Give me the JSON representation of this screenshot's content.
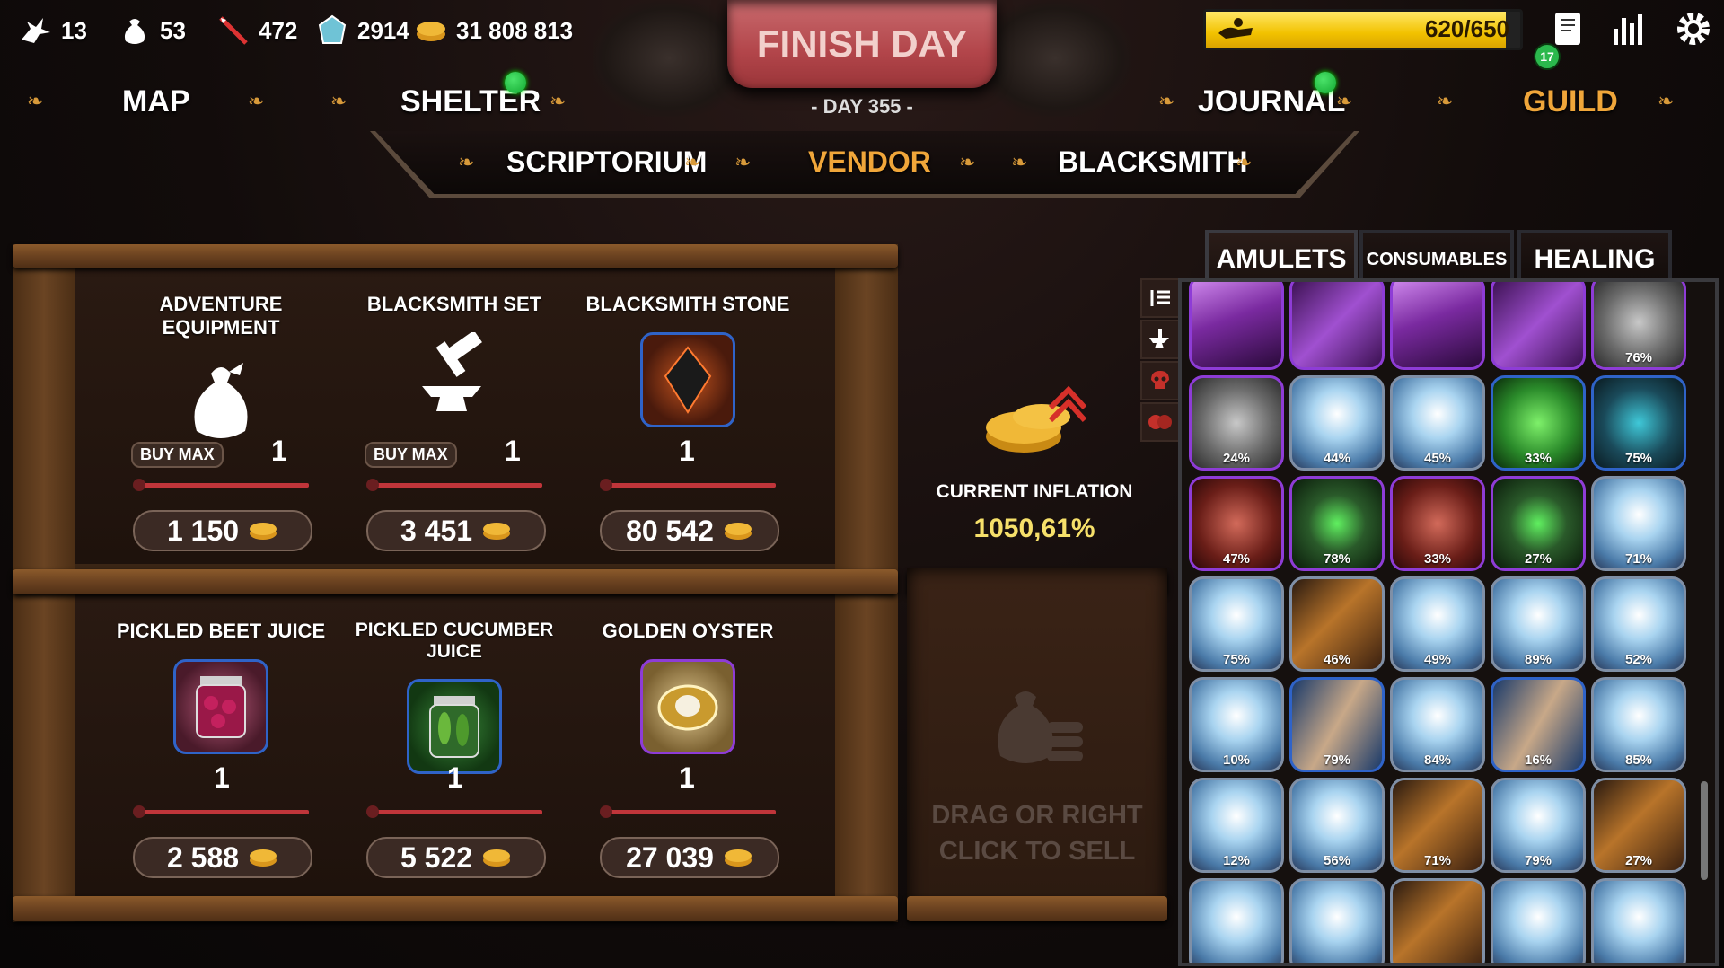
{
  "top_stats": [
    {
      "icon": "dragon-icon",
      "value": "13"
    },
    {
      "icon": "sack-icon",
      "value": "53"
    },
    {
      "icon": "quill-icon",
      "value": "472"
    },
    {
      "icon": "gem-icon",
      "value": "2914"
    },
    {
      "icon": "gold-coins-icon",
      "value": "31 808 813"
    }
  ],
  "finish_day_label": "FINISH DAY",
  "day_label": "- DAY 355 -",
  "progress": {
    "text": "620/650",
    "fraction": 0.954
  },
  "notification_count": "17",
  "nav": {
    "map": "MAP",
    "shelter": "SHELTER",
    "journal": "JOURNAL",
    "guild": "GUILD",
    "scriptorium": "SCRIPTORIUM",
    "vendor": "VENDOR",
    "blacksmith": "BLACKSMITH"
  },
  "shop_items": [
    {
      "name": "ADVENTURE EQUIPMENT",
      "icon": "sack-icon",
      "qty": "1",
      "price": "1 150",
      "buy_max": "BUY MAX"
    },
    {
      "name": "BLACKSMITH SET",
      "icon": "anvil-hammer-icon",
      "qty": "1",
      "price": "3 451",
      "buy_max": "BUY MAX"
    },
    {
      "name": "BLACKSMITH STONE",
      "icon": "black-crystal-icon",
      "qty": "1",
      "price": "80 542"
    },
    {
      "name": "PICKLED BEET JUICE",
      "icon": "beet-jar-icon",
      "qty": "1",
      "price": "2 588"
    },
    {
      "name": "PICKLED CUCUMBER JUICE",
      "icon": "cucumber-jar-icon",
      "qty": "1",
      "price": "5 522"
    },
    {
      "name": "GOLDEN OYSTER",
      "icon": "golden-oyster-icon",
      "qty": "1",
      "price": "27 039"
    }
  ],
  "inflation": {
    "label": "CURRENT INFLATION",
    "value": "1050,61%"
  },
  "sell_hint": "DRAG OR RIGHT CLICK TO SELL",
  "tabs": {
    "amulets": "AMULETS",
    "consumables": "CONSUMABLES",
    "healing": "HEALING"
  },
  "inventory": [
    {
      "kind": "purple-crystal",
      "rarity": "purple",
      "pct": ""
    },
    {
      "kind": "purple-staff",
      "rarity": "purple",
      "pct": ""
    },
    {
      "kind": "purple-crystal",
      "rarity": "purple",
      "pct": ""
    },
    {
      "kind": "purple-staff",
      "rarity": "purple",
      "pct": ""
    },
    {
      "kind": "wolf-medallion",
      "rarity": "purple",
      "pct": "76%"
    },
    {
      "kind": "wolf-medallion",
      "rarity": "purple",
      "pct": "24%"
    },
    {
      "kind": "ice-crystal",
      "rarity": "grey",
      "pct": "44%"
    },
    {
      "kind": "ice-crystal",
      "rarity": "grey",
      "pct": "45%"
    },
    {
      "kind": "green-herb",
      "rarity": "blue",
      "pct": "33%"
    },
    {
      "kind": "blue-eggs",
      "rarity": "blue",
      "pct": "75%"
    },
    {
      "kind": "red-claw",
      "rarity": "purple",
      "pct": "47%"
    },
    {
      "kind": "green-spirit",
      "rarity": "purple",
      "pct": "78%"
    },
    {
      "kind": "red-claw",
      "rarity": "purple",
      "pct": "33%"
    },
    {
      "kind": "green-spirit",
      "rarity": "purple",
      "pct": "27%"
    },
    {
      "kind": "ice-crystal",
      "rarity": "grey",
      "pct": "71%"
    },
    {
      "kind": "ice-crystal",
      "rarity": "grey",
      "pct": "75%"
    },
    {
      "kind": "bronze-claws",
      "rarity": "grey",
      "pct": "46%"
    },
    {
      "kind": "ice-crystal",
      "rarity": "grey",
      "pct": "49%"
    },
    {
      "kind": "ice-crystal",
      "rarity": "grey",
      "pct": "89%"
    },
    {
      "kind": "ice-crystal",
      "rarity": "grey",
      "pct": "52%"
    },
    {
      "kind": "ice-crystal",
      "rarity": "grey",
      "pct": "10%"
    },
    {
      "kind": "blue-cloth",
      "rarity": "blue",
      "pct": "79%"
    },
    {
      "kind": "ice-crystal",
      "rarity": "grey",
      "pct": "84%"
    },
    {
      "kind": "blue-cloth",
      "rarity": "blue",
      "pct": "16%"
    },
    {
      "kind": "ice-crystal",
      "rarity": "grey",
      "pct": "85%"
    },
    {
      "kind": "ice-crystal",
      "rarity": "grey",
      "pct": "12%"
    },
    {
      "kind": "ice-crystal",
      "rarity": "grey",
      "pct": "56%"
    },
    {
      "kind": "bronze-claws",
      "rarity": "grey",
      "pct": "71%"
    },
    {
      "kind": "ice-crystal",
      "rarity": "grey",
      "pct": "79%"
    },
    {
      "kind": "bronze-claws",
      "rarity": "grey",
      "pct": "27%"
    },
    {
      "kind": "ice-crystal",
      "rarity": "grey",
      "pct": ""
    },
    {
      "kind": "ice-crystal",
      "rarity": "grey",
      "pct": ""
    },
    {
      "kind": "bronze-claws",
      "rarity": "grey",
      "pct": ""
    },
    {
      "kind": "ice-crystal",
      "rarity": "grey",
      "pct": ""
    },
    {
      "kind": "ice-crystal",
      "rarity": "grey",
      "pct": ""
    }
  ],
  "colors": {
    "accent": "#f0a63a",
    "progress": "#f2c200",
    "price_bar": "#c0353a",
    "inflation": "#f6e06a"
  }
}
